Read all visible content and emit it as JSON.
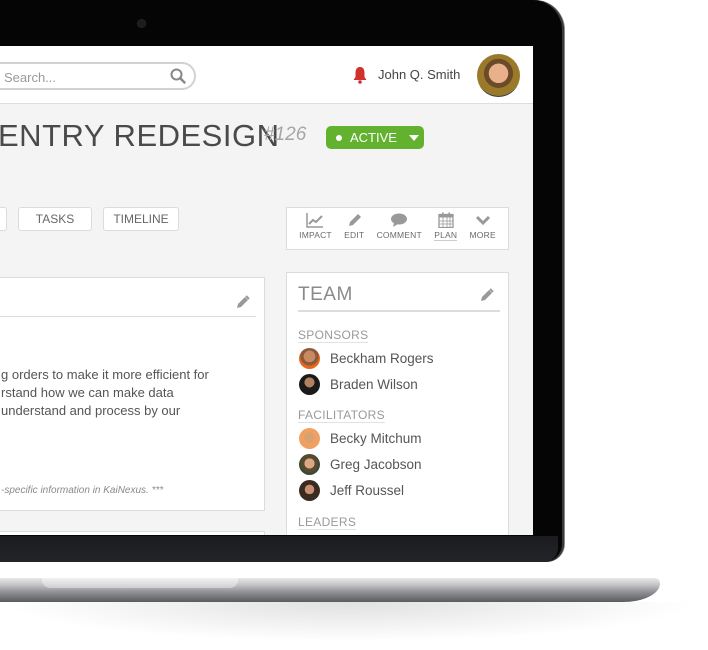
{
  "topbar": {
    "search_placeholder": "Search...",
    "user_name": "John Q. Smith"
  },
  "header": {
    "title": "ENTRY REDESIGN",
    "number": "#126",
    "status": "ACTIVE",
    "status_color": "#62b22f"
  },
  "tabs": [
    {
      "label": ""
    },
    {
      "label": "TASKS"
    },
    {
      "label": "TIMELINE"
    }
  ],
  "actions": [
    {
      "label": "IMPACT",
      "icon": "chart-line-icon"
    },
    {
      "label": "EDIT",
      "icon": "pencil-icon"
    },
    {
      "label": "COMMENT",
      "icon": "speech-bubble-icon"
    },
    {
      "label": "PLAN",
      "icon": "calendar-icon"
    },
    {
      "label": "MORE",
      "icon": "chevron-down-icon"
    }
  ],
  "description": {
    "lines": [
      "g orders to make it more efficient for",
      "rstand how we can make data",
      "understand and process by our"
    ],
    "note": "-specific information in KaiNexus. ***"
  },
  "team": {
    "title": "TEAM",
    "sections": [
      {
        "label": "SPONSORS",
        "members": [
          "Beckham Rogers",
          "Braden Wilson"
        ]
      },
      {
        "label": "FACILITATORS",
        "members": [
          "Becky Mitchum",
          "Greg Jacobson",
          "Jeff Roussel"
        ]
      },
      {
        "label": "LEADERS",
        "members": []
      }
    ]
  }
}
